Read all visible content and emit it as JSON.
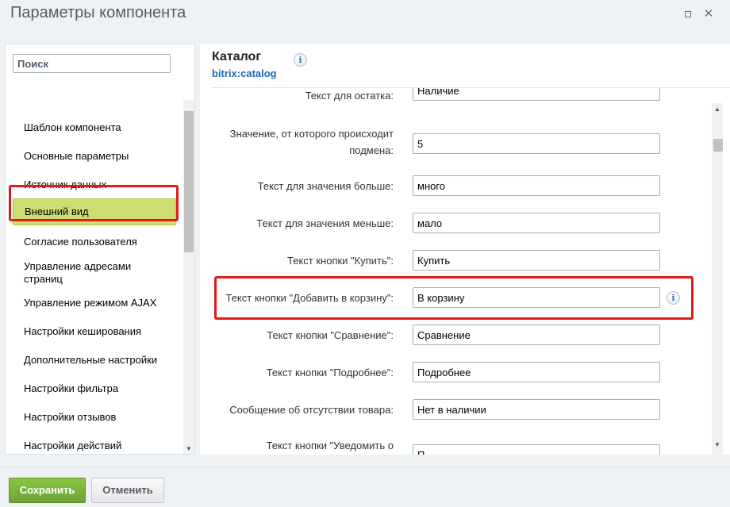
{
  "dialog": {
    "title": "Параметры компонента"
  },
  "search": {
    "placeholder": "Поиск"
  },
  "nav": {
    "items": [
      "Шаблон компонента",
      "Основные параметры",
      "Источник данных",
      "Внешний вид",
      "Согласие пользователя",
      "Управление адресами\nстраниц",
      "Управление режимом AJAX",
      "Настройки кеширования",
      "Дополнительные настройки",
      "Настройки фильтра",
      "Настройки отзывов",
      "Настройки действий"
    ],
    "active": "Внешний вид"
  },
  "component": {
    "name": "Каталог",
    "code": "bitrix:catalog"
  },
  "form": {
    "rows": [
      {
        "label": "Текст для остатка:",
        "value": "Наличие"
      },
      {
        "label": "Значение, от которого происходит\nподмена:",
        "value": "5"
      },
      {
        "label": "Текст для значения больше:",
        "value": "много"
      },
      {
        "label": "Текст для значения меньше:",
        "value": "мало"
      },
      {
        "label": "Текст кнопки \"Купить\":",
        "value": "Купить"
      },
      {
        "label": "Текст кнопки \"Добавить в корзину\":",
        "value": "В корзину"
      },
      {
        "label": "Текст кнопки \"Сравнение\":",
        "value": "Сравнение"
      },
      {
        "label": "Текст кнопки \"Подробнее\":",
        "value": "Подробнее"
      },
      {
        "label": "Сообщение об отсутствии товара:",
        "value": "Нет в наличии"
      },
      {
        "label": "Текст кнопки \"Уведомить о",
        "value": "П"
      }
    ]
  },
  "footer": {
    "save_label": "Сохранить",
    "cancel_label": "Отменить"
  },
  "colors": {
    "accent_green": "#8bc53f",
    "highlight_red": "#e01919",
    "active_item": "#cddd71",
    "link_blue": "#2067b0"
  }
}
